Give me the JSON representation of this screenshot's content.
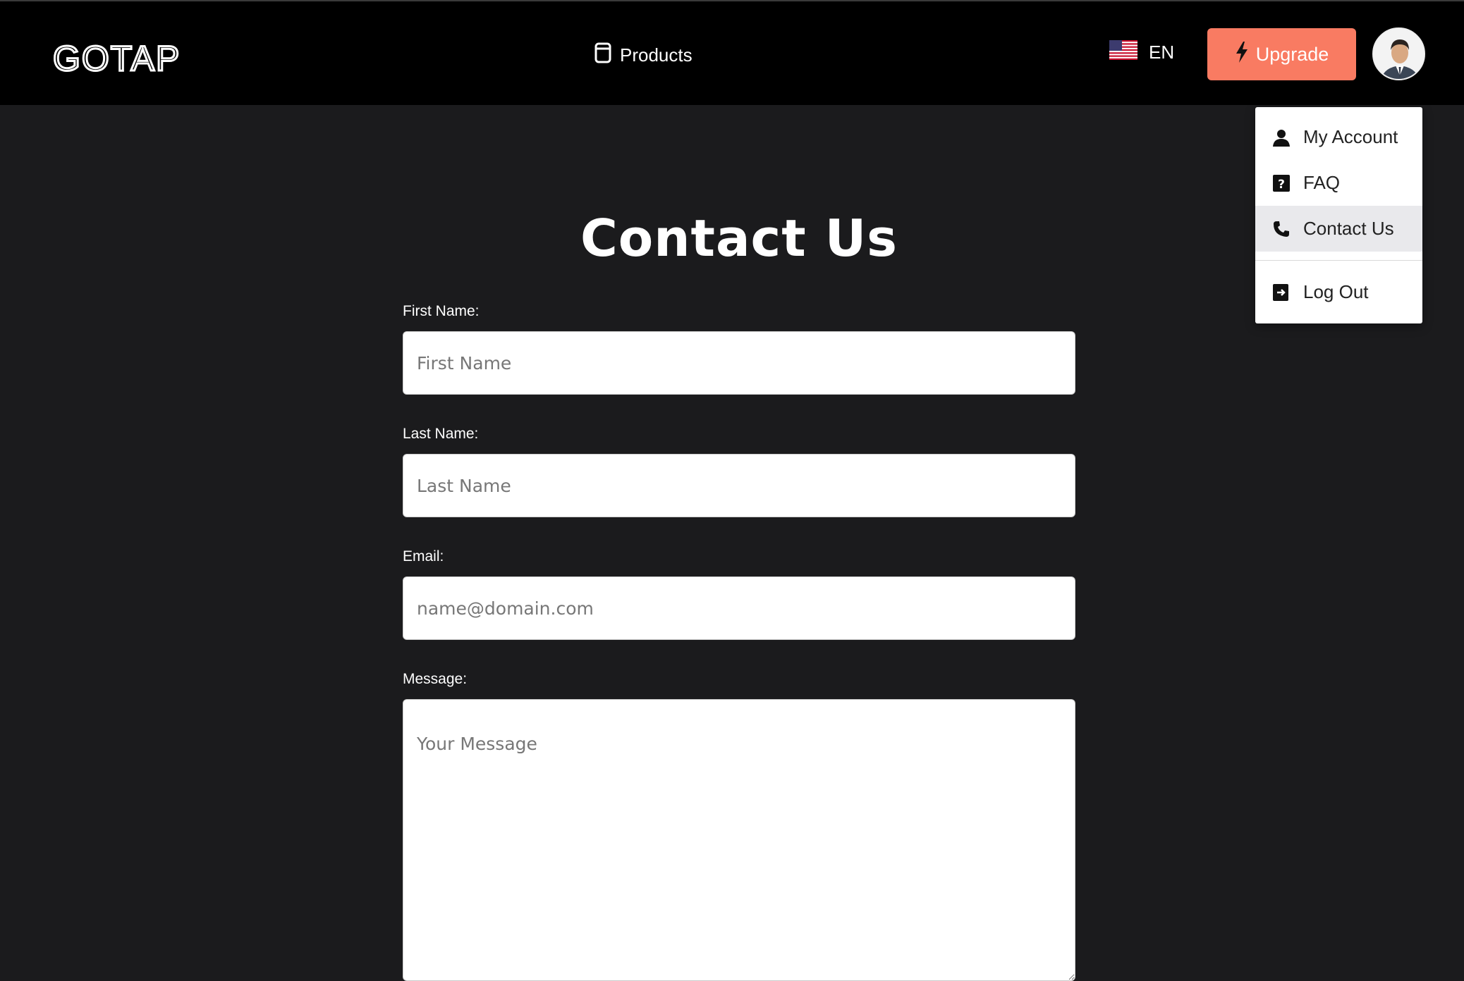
{
  "header": {
    "logo_text": "GOTAP",
    "products_label": "Products",
    "language_code": "EN",
    "upgrade_label": "Upgrade"
  },
  "account_menu": {
    "items": [
      {
        "label": "My Account",
        "icon": "user-icon"
      },
      {
        "label": "FAQ",
        "icon": "question-icon"
      },
      {
        "label": "Contact Us",
        "icon": "phone-icon",
        "active": true
      },
      {
        "label": "Log Out",
        "icon": "logout-icon"
      }
    ]
  },
  "page": {
    "title": "Contact Us"
  },
  "form": {
    "first_name": {
      "label": "First Name:",
      "placeholder": "First Name",
      "value": ""
    },
    "last_name": {
      "label": "Last Name:",
      "placeholder": "Last Name",
      "value": ""
    },
    "email": {
      "label": "Email:",
      "placeholder": "name@domain.com",
      "value": ""
    },
    "message": {
      "label": "Message:",
      "placeholder": "Your Message",
      "value": ""
    }
  },
  "colors": {
    "accent": "#f97b62",
    "header_bg": "#000000",
    "page_bg": "#1b1b1d"
  }
}
